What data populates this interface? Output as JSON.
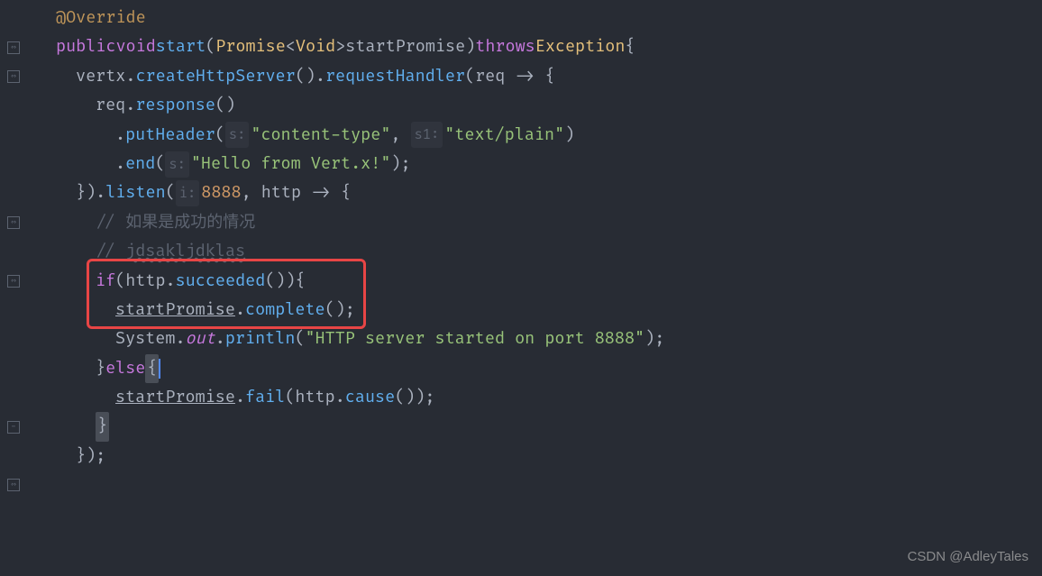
{
  "annotation": "@Override",
  "kw": {
    "public": "public",
    "void": "void",
    "throws": "throws",
    "if": "if",
    "else": "else"
  },
  "methods": {
    "start": "start",
    "createHttpServer": "createHttpServer",
    "requestHandler": "requestHandler",
    "response": "response",
    "putHeader": "putHeader",
    "end": "end",
    "listen": "listen",
    "succeeded": "succeeded",
    "complete": "complete",
    "println": "println",
    "fail": "fail",
    "cause": "cause"
  },
  "types": {
    "Promise": "Promise",
    "Void": "Void",
    "Exception": "Exception"
  },
  "ids": {
    "vertx": "vertx",
    "req": "req",
    "http": "http",
    "startPromise": "startPromise",
    "System": "System",
    "out": "out"
  },
  "hints": {
    "s": "s:",
    "s1": "s1:",
    "i": "i:"
  },
  "strings": {
    "contentType": "\"content-type\"",
    "textPlain": "\"text/plain\"",
    "hello": "\"Hello from Vert.x!\"",
    "started": "\"HTTP server started on port 8888\""
  },
  "numbers": {
    "port": "8888"
  },
  "comments": {
    "line1": "// 如果是成功的情况",
    "line2_prefix": "// ",
    "line2_text": "jdsakljdklas"
  },
  "watermark": "CSDN @AdleyTales",
  "p": {
    "lparen": "(",
    "rparen": ")",
    "lbrace": "{",
    "rbrace": "}",
    "lt": "<",
    "gt": ">",
    "dot": ".",
    "comma": ", ",
    "semi": ";",
    "arrow": " -> ",
    "rparenDot": ")."
  }
}
